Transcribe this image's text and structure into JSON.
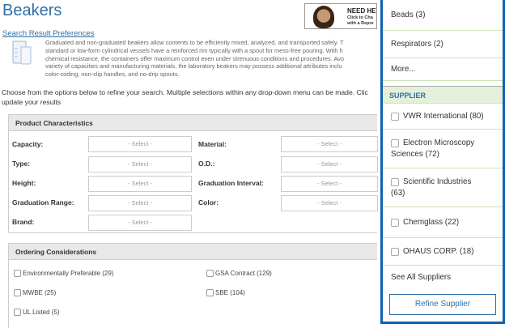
{
  "page": {
    "title": "Beakers",
    "preferences_link": "Search Result Preferences",
    "promo": {
      "line1": "NEED HEL",
      "line2a": "Click to Cha",
      "line2b": "with a Repre"
    },
    "description": [
      "Graduated and non-graduated beakers allow contents to be efficiently mixed, analyzed, and transported safely. T",
      "standard or low-form cylindrical vessels have a reinforced rim typically with a spout for mess-free pouring. With h",
      "chemical resistance, the containers offer maximum control even under strenuous conditions and procedures. Avo",
      "variety of capacities and manufacturing materials, the laboratory beakers may possess additional attributes inclu",
      "color-coding, non-slip handles, and no-drip spouts."
    ],
    "intro": [
      "Choose from the options below to refine your search. Multiple selections within any drop-down menu can be made. Clic",
      "update your results"
    ]
  },
  "product_characteristics": {
    "header": "Product Characteristics",
    "fields": [
      {
        "label": "Capacity:",
        "value": "- Select -"
      },
      {
        "label": "Material:",
        "value": "- Select -"
      },
      {
        "label": "Type:",
        "value": "- Select -"
      },
      {
        "label": "O.D.:",
        "value": "- Select -"
      },
      {
        "label": "Height:",
        "value": "- Select -"
      },
      {
        "label": "Graduation Interval:",
        "value": "- Select -"
      },
      {
        "label": "Graduation Range:",
        "value": "- Select -"
      },
      {
        "label": "Color:",
        "value": "- Select -"
      },
      {
        "label": "Brand:",
        "value": "- Select -"
      }
    ]
  },
  "ordering_considerations": {
    "header": "Ordering Considerations",
    "options": [
      "Environmentally Preferable (29)",
      "GSA Contract (129)",
      "MWBE (25)",
      "SBE (104)",
      "UL Listed (5)"
    ]
  },
  "side_panel": {
    "top_items": [
      "Beads (3)",
      "Respirators (2)",
      "More..."
    ],
    "supplier_header": "SUPPLIER",
    "suppliers": [
      {
        "line1": "VWR International (80)",
        "line2": ""
      },
      {
        "line1": "Electron Microscopy",
        "line2": "Sciences (72)"
      },
      {
        "line1": "Scientific Industries",
        "line2": "(63)"
      },
      {
        "line1": "Chemglass (22)",
        "line2": ""
      },
      {
        "line1": "OHAUS CORP. (18)",
        "line2": ""
      }
    ],
    "see_all": "See All Suppliers",
    "refine_button": "Refine Supplier"
  }
}
